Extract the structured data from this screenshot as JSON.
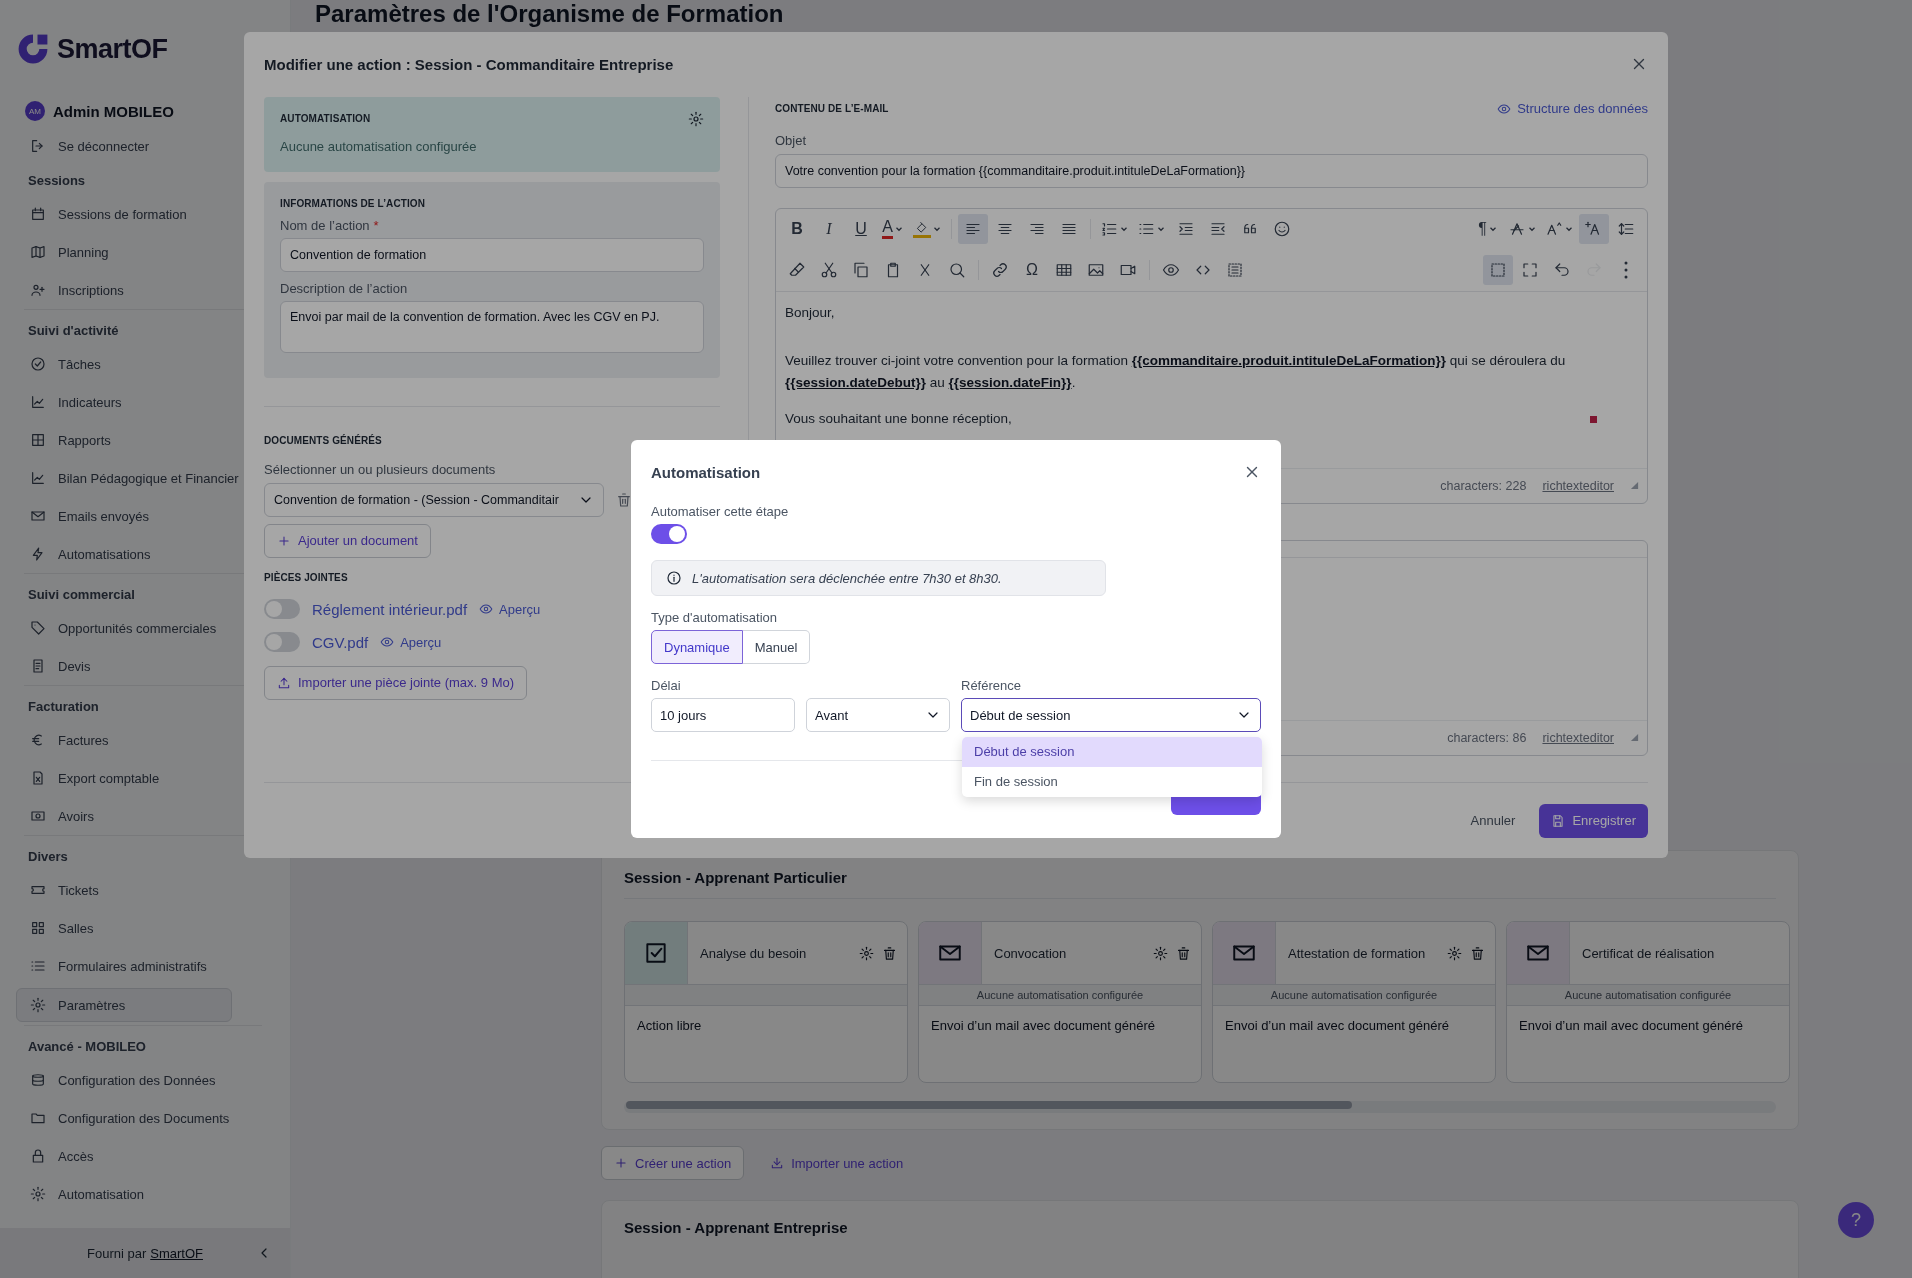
{
  "app": {
    "logo": "SmartOF",
    "user": {
      "initials": "AM",
      "name": "Admin MOBILEO"
    },
    "logout": "Se déconnecter"
  },
  "sidebar": {
    "sections": [
      {
        "title": "Sessions",
        "items": [
          {
            "label": "Sessions de formation",
            "selected": false
          },
          {
            "label": "Planning",
            "selected": false
          },
          {
            "label": "Inscriptions",
            "selected": false
          }
        ]
      },
      {
        "title": "Suivi d'activité",
        "items": [
          {
            "label": "Tâches",
            "selected": false
          },
          {
            "label": "Indicateurs",
            "selected": false
          },
          {
            "label": "Rapports",
            "selected": false
          },
          {
            "label": "Bilan Pédagogique et Financier",
            "selected": false
          },
          {
            "label": "Emails envoyés",
            "selected": false
          },
          {
            "label": "Automatisations",
            "selected": false
          }
        ]
      },
      {
        "title": "Suivi commercial",
        "items": [
          {
            "label": "Opportunités commerciales",
            "selected": false
          },
          {
            "label": "Devis",
            "selected": false
          }
        ]
      },
      {
        "title": "Facturation",
        "items": [
          {
            "label": "Factures",
            "selected": false
          },
          {
            "label": "Export comptable",
            "selected": false
          },
          {
            "label": "Avoirs",
            "selected": false
          }
        ]
      },
      {
        "title": "Divers",
        "items": [
          {
            "label": "Tickets",
            "selected": false
          },
          {
            "label": "Salles",
            "selected": false
          },
          {
            "label": "Formulaires administratifs",
            "selected": false
          },
          {
            "label": "Paramètres",
            "selected": true
          }
        ]
      },
      {
        "title": "Avancé - MOBILEO",
        "items": [
          {
            "label": "Configuration des Données",
            "selected": false
          },
          {
            "label": "Configuration des Documents",
            "selected": false
          },
          {
            "label": "Accès",
            "selected": false
          },
          {
            "label": "Automatisation",
            "selected": false
          }
        ]
      }
    ],
    "footer": {
      "text": "Fourni par",
      "link": "SmartOF"
    }
  },
  "page": {
    "title": "Paramètres de l'Organisme de Formation",
    "group": {
      "title": "Session - Apprenant Particulier",
      "actions": [
        {
          "title": "Analyse du besoin",
          "kind": "task",
          "tools": true,
          "description": "Action libre"
        },
        {
          "title": "Convocation",
          "kind": "email",
          "tools": true,
          "automation": "Aucune automatisation configurée",
          "description": "Envoi d’un mail avec document généré"
        },
        {
          "title": "Attestation de formation",
          "kind": "email",
          "tools": true,
          "automation": "Aucune automatisation configurée",
          "description": "Envoi d’un mail avec document généré"
        },
        {
          "title": "Certificat de réalisation",
          "kind": "email",
          "tools": false,
          "automation": "Aucune automatisation configurée",
          "description": "Envoi d’un mail avec document généré"
        }
      ]
    },
    "buttons": [
      {
        "label": "Créer une action",
        "kind": "outline"
      },
      {
        "label": "Importer une action",
        "kind": "link"
      }
    ],
    "next_group": "Session - Apprenant Entreprise",
    "help": "?"
  },
  "modal": {
    "title": "Modifier une action : Session - Commanditaire Entreprise",
    "automation_panel": {
      "title": "AUTOMATISATION",
      "status": "Aucune automatisation configurée"
    },
    "info": {
      "title": "INFORMATIONS DE L’ACTION",
      "name_label": "Nom de l’action",
      "required_mark": "*",
      "name_value": "Convention de formation",
      "description_label": "Description de l’action",
      "description_value": "Envoi par mail de la convention de formation. Avec les CGV en PJ."
    },
    "documents": {
      "title": "DOCUMENTS GÉNÉRÉS",
      "label": "Sélectionner un ou plusieurs documents",
      "value": "Convention de formation - (Session - Commanditair",
      "add_button": "Ajouter un document"
    },
    "attachments": {
      "title": "PIÈCES JOINTES",
      "items": [
        {
          "name": "Réglement intérieur.pdf",
          "on": false,
          "preview": "Aperçu"
        },
        {
          "name": "CGV.pdf",
          "on": false,
          "preview": "Aperçu"
        }
      ],
      "import_button": "Importer une pièce jointe (max. 9 Mo)"
    },
    "email": {
      "title": "CONTENU DE L’E-MAIL",
      "data_link": "Structure des données",
      "subject_label": "Objet",
      "subject": "Votre convention pour la formation {{commanditaire.produit.intituleDeLaFormation}}",
      "toolbar": [
        {
          "left": [
            {
              "label": "B",
              "selected": false,
              "disabled": false
            },
            {
              "label": "I",
              "selected": false,
              "disabled": false
            },
            {
              "label": "U",
              "selected": false,
              "disabled": false
            },
            {
              "label": "A",
              "selected": false,
              "disabled": false
            },
            {
              "selected": false,
              "disabled": false
            },
            {
              "selected": true,
              "disabled": false
            },
            {
              "selected": false,
              "disabled": false
            },
            {
              "selected": false,
              "disabled": false
            },
            {
              "selected": false,
              "disabled": false
            },
            {
              "selected": false,
              "disabled": false
            },
            {
              "selected": false,
              "disabled": false
            },
            {
              "selected": false,
              "disabled": false
            },
            {
              "selected": false,
              "disabled": false
            },
            {
              "selected": false,
              "disabled": false
            },
            {
              "selected": false,
              "disabled": false
            }
          ],
          "right": [
            {
              "label": "¶",
              "selected": false,
              "disabled": false
            },
            {
              "selected": false,
              "disabled": false
            },
            {
              "selected": false,
              "disabled": false
            },
            {
              "selected": true,
              "disabled": false
            },
            {
              "selected": false,
              "disabled": false
            }
          ]
        },
        {
          "left": [
            {
              "selected": false,
              "disabled": false
            },
            {
              "selected": false,
              "disabled": false
            },
            {
              "selected": false,
              "disabled": false
            },
            {
              "selected": false,
              "disabled": false
            },
            {
              "selected": false,
              "disabled": false
            },
            {
              "selected": false,
              "disabled": false
            },
            {
              "selected": false,
              "disabled": false
            },
            {
              "label": "Ω",
              "selected": false,
              "disabled": false
            },
            {
              "selected": false,
              "disabled": false
            },
            {
              "selected": false,
              "disabled": false
            },
            {
              "selected": false,
              "disabled": false
            },
            {
              "selected": false,
              "disabled": false
            },
            {
              "selected": false,
              "disabled": false
            },
            {
              "selected": false,
              "disabled": false
            }
          ],
          "right": [
            {
              "selected": true,
              "disabled": false
            },
            {
              "selected": false,
              "disabled": false
            },
            {
              "selected": false,
              "disabled": false
            },
            {
              "selected": false,
              "disabled": true
            },
            {
              "selected": false,
              "disabled": false
            }
          ]
        }
      ],
      "body": [
        "Bonjour,",
        "Veuillez trouver ci-joint votre convention pour la formation **{{commanditaire.produit.intituleDeLaFormation}}** qui se déroulera du **{{session.dateDebut}}** au **{{session.dateFin}}**.",
        "Vous souhaitant une bonne réception,"
      ],
      "char_count": "characters: 228",
      "brand": "richtexteditor"
    },
    "second_editor": {
      "char_count": "characters: 86",
      "brand": "richtexteditor"
    },
    "buttons": [
      {
        "label": "Annuler",
        "kind": "text"
      },
      {
        "label": "Enregistrer",
        "kind": "primary"
      }
    ]
  },
  "dialog": {
    "title": "Automatisation",
    "toggle_label": "Automatiser cette étape",
    "toggle_on": true,
    "info": "L'automatisation sera déclenchée entre 7h30 et 8h30.",
    "type_label": "Type d'automatisation",
    "types": [
      {
        "label": "Dynamique",
        "selected": true
      },
      {
        "label": "Manuel",
        "selected": false
      }
    ],
    "delay_label": "Délai",
    "delay_value": "10 jours",
    "direction": "Avant",
    "reference_label": "Référence",
    "reference_value": "Début de session",
    "reference_options": [
      {
        "label": "Début de session",
        "selected": true
      },
      {
        "label": "Fin de session",
        "selected": false
      }
    ],
    "primary_button": true
  }
}
